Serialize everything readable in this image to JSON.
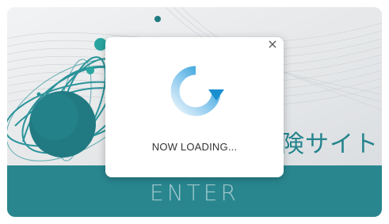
{
  "background": {
    "title_partial": "サイト",
    "title_partial_visible_fragment": "険",
    "enter_label": "ENTER"
  },
  "modal": {
    "close_label": "×",
    "loading_text": "NOW LOADING...",
    "spinner_icon": "refresh-spinner-icon"
  },
  "colors": {
    "accent_teal": "#177c86",
    "spinner_blue": "#1fa0dc",
    "spinner_light": "#c9e6f6",
    "hero_bg": "#e6e8ea"
  }
}
